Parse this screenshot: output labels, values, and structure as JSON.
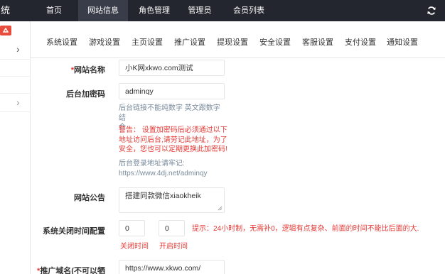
{
  "app": {
    "title": "统"
  },
  "nav": [
    {
      "label": "首页"
    },
    {
      "label": "网站信息"
    },
    {
      "label": "角色管理"
    },
    {
      "label": "管理员"
    },
    {
      "label": "会员列表"
    }
  ],
  "tabs": [
    {
      "label": "系统设置"
    },
    {
      "label": "游戏设置"
    },
    {
      "label": "主页设置"
    },
    {
      "label": "推广设置"
    },
    {
      "label": "提现设置"
    },
    {
      "label": "安全设置"
    },
    {
      "label": "客服设置"
    },
    {
      "label": "支付设置"
    },
    {
      "label": "通知设置"
    }
  ],
  "form": {
    "site_name": {
      "label": "网站名称",
      "required_mark": "*",
      "value": "小K网xkwo.com测试"
    },
    "admin_code": {
      "label": "后台加密码",
      "value": "adminqy",
      "help": [
        "后台链接不能纯数字 英文跟数字结",
        "合"
      ],
      "warning": [
        "警告： 设置加密码后必须通过以下",
        "地址访问后台,请劳记此地址，为了",
        "安全，您也可以定期更换此加密码!"
      ],
      "login_hint": [
        "后台登录地址请牢记:",
        "https://www.4dj.net/adminqy"
      ]
    },
    "notice": {
      "label": "网站公告",
      "value": "搭建同款微信xiaokheik"
    },
    "close_time": {
      "label": "系统关闭时间配置",
      "close_value": "0",
      "open_value": "0",
      "tip": "提示：24小时制，无需补0，逻辑有点复杂、前面的时间不能比后面的大.",
      "close_label": "关闭时间",
      "open_label": "开启时间"
    },
    "promo_domain": {
      "label": "推广域名(不可以牺",
      "required_mark": "*",
      "value": "https://www.xkwo.com/"
    }
  },
  "colors": {
    "topbar": "#23262e",
    "active_nav": "#393d49",
    "warning": "#e53935",
    "help": "#7a8b9c"
  }
}
